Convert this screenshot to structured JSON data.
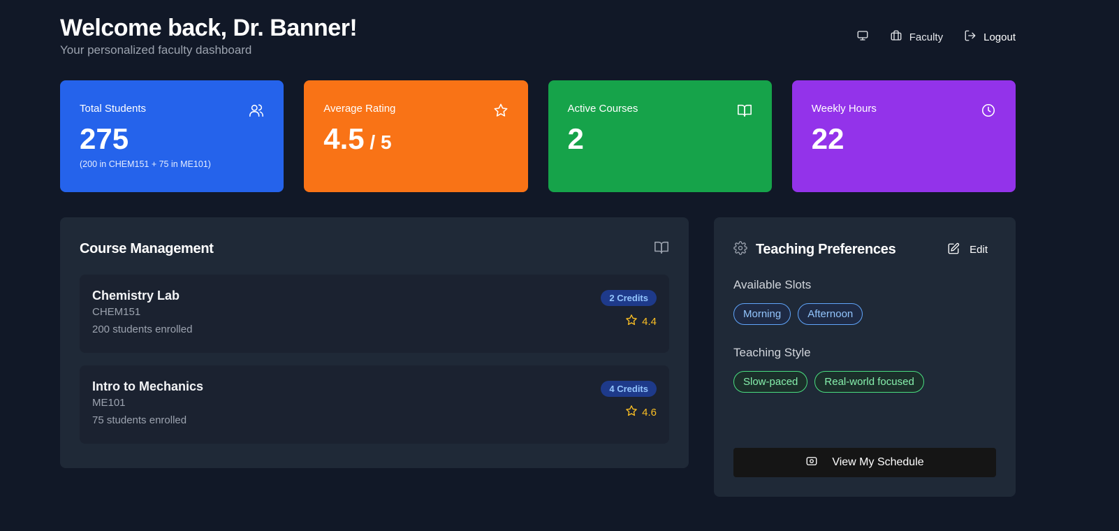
{
  "header": {
    "title": "Welcome back, Dr. Banner!",
    "subtitle": "Your personalized faculty dashboard"
  },
  "nav": {
    "faculty_label": "Faculty",
    "logout_label": "Logout"
  },
  "stats": [
    {
      "label": "Total Students",
      "value": "275",
      "note": "(200 in CHEM151 + 75 in ME101)",
      "icon": "users-icon",
      "color": "#2563eb"
    },
    {
      "label": "Average Rating",
      "value": "4.5",
      "suffix": " / 5",
      "icon": "star-icon",
      "color": "#f97316"
    },
    {
      "label": "Active Courses",
      "value": "2",
      "icon": "book-open-icon",
      "color": "#16a34a"
    },
    {
      "label": "Weekly Hours",
      "value": "22",
      "icon": "clock-icon",
      "color": "#9333ea"
    }
  ],
  "courses": {
    "title": "Course Management",
    "items": [
      {
        "name": "Chemistry Lab",
        "code": "CHEM151",
        "enrolled": "200 students enrolled",
        "credits": "2 Credits",
        "rating": "4.4"
      },
      {
        "name": "Intro to Mechanics",
        "code": "ME101",
        "enrolled": "75 students enrolled",
        "credits": "4 Credits",
        "rating": "4.6"
      }
    ]
  },
  "preferences": {
    "title": "Teaching Preferences",
    "edit_label": "Edit",
    "slots_label": "Available Slots",
    "slots": [
      "Morning",
      "Afternoon"
    ],
    "style_label": "Teaching Style",
    "styles": [
      "Slow-paced",
      "Real-world focused"
    ],
    "schedule_button": "View My Schedule"
  }
}
